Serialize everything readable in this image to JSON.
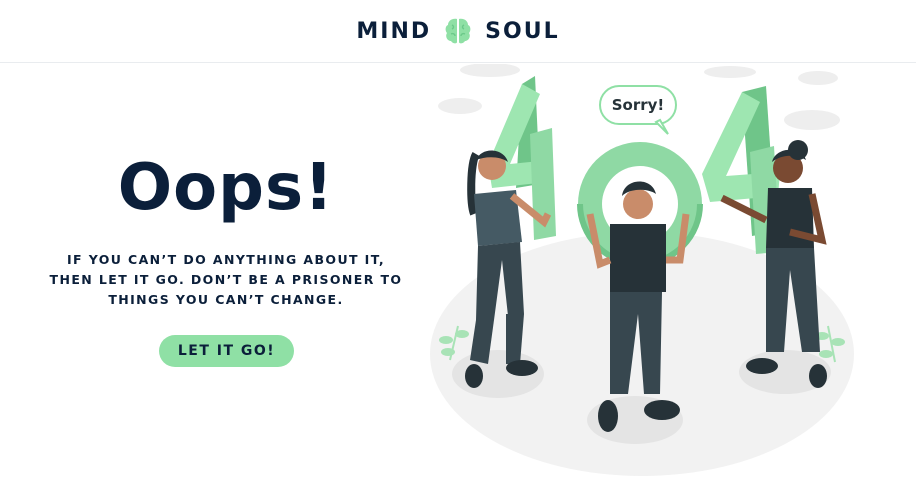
{
  "header": {
    "brand_left": "MIND",
    "brand_right": "SOUL",
    "brand_icon": "brain-icon"
  },
  "main": {
    "heading": "Oops!",
    "message_lines": [
      "IF YOU CAN’T DO ANYTHING ABOUT IT,",
      "THEN LET IT GO. DON’T BE A PRISONER TO",
      "THINGS YOU CAN’T CHANGE."
    ],
    "cta_label": "LET IT GO!"
  },
  "illustration": {
    "speech_bubble": "Sorry!",
    "digits": [
      "4",
      "0",
      "4"
    ]
  },
  "colors": {
    "brand_dark": "#0b1f3a",
    "accent_green": "#8fe0a5",
    "figure_dark": "#37474f",
    "floor": "#f2f2f2"
  }
}
